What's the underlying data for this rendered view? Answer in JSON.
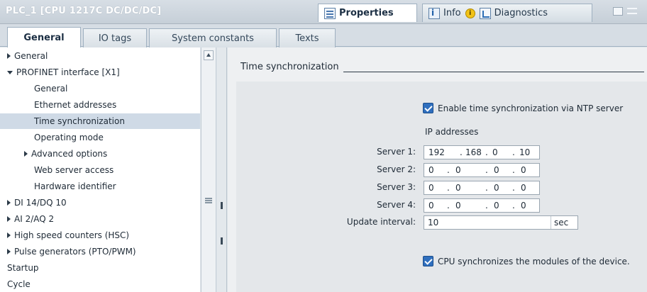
{
  "window": {
    "title": "PLC_1 [CPU 1217C DC/DC/DC]",
    "properties_label": "Properties",
    "info_label": "Info",
    "diagnostics_label": "Diagnostics"
  },
  "tabs": [
    {
      "label": "General",
      "active": true
    },
    {
      "label": "IO tags",
      "active": false
    },
    {
      "label": "System constants",
      "active": false
    },
    {
      "label": "Texts",
      "active": false
    }
  ],
  "nav": {
    "items": [
      {
        "label": "General",
        "level": 0,
        "expander": "collapsed"
      },
      {
        "label": "PROFINET interface [X1]",
        "level": 0,
        "expander": "expanded"
      },
      {
        "label": "General",
        "level": 1,
        "expander": "none"
      },
      {
        "label": "Ethernet addresses",
        "level": 1,
        "expander": "none"
      },
      {
        "label": "Time synchronization",
        "level": 1,
        "expander": "none",
        "selected": true
      },
      {
        "label": "Operating mode",
        "level": 1,
        "expander": "none"
      },
      {
        "label": "Advanced options",
        "level": 1,
        "expander": "collapsed"
      },
      {
        "label": "Web server access",
        "level": 1,
        "expander": "none"
      },
      {
        "label": "Hardware identifier",
        "level": 1,
        "expander": "none"
      },
      {
        "label": "DI 14/DQ 10",
        "level": 0,
        "expander": "collapsed"
      },
      {
        "label": "AI 2/AQ 2",
        "level": 0,
        "expander": "collapsed"
      },
      {
        "label": "High speed counters (HSC)",
        "level": 0,
        "expander": "collapsed"
      },
      {
        "label": "Pulse generators (PTO/PWM)",
        "level": 0,
        "expander": "collapsed"
      },
      {
        "label": "Startup",
        "level": 0,
        "expander": "none"
      },
      {
        "label": "Cycle",
        "level": 0,
        "expander": "none"
      }
    ]
  },
  "content": {
    "section_title": "Time synchronization",
    "ntp_checkbox_label": "Enable time synchronization via NTP server",
    "ntp_enabled": true,
    "ip_addresses_label": "IP addresses",
    "servers": [
      {
        "label": "Server 1:",
        "octets": [
          "192",
          "168",
          "0",
          "10"
        ]
      },
      {
        "label": "Server 2:",
        "octets": [
          "0",
          "0",
          "0",
          "0"
        ]
      },
      {
        "label": "Server 3:",
        "octets": [
          "0",
          "0",
          "0",
          "0"
        ]
      },
      {
        "label": "Server 4:",
        "octets": [
          "0",
          "0",
          "0",
          "0"
        ]
      }
    ],
    "update_interval_label": "Update interval:",
    "update_interval_value": "10",
    "update_interval_unit": "sec",
    "sync_modules_label": "CPU synchronizes the modules of the device.",
    "sync_modules_enabled": true
  }
}
